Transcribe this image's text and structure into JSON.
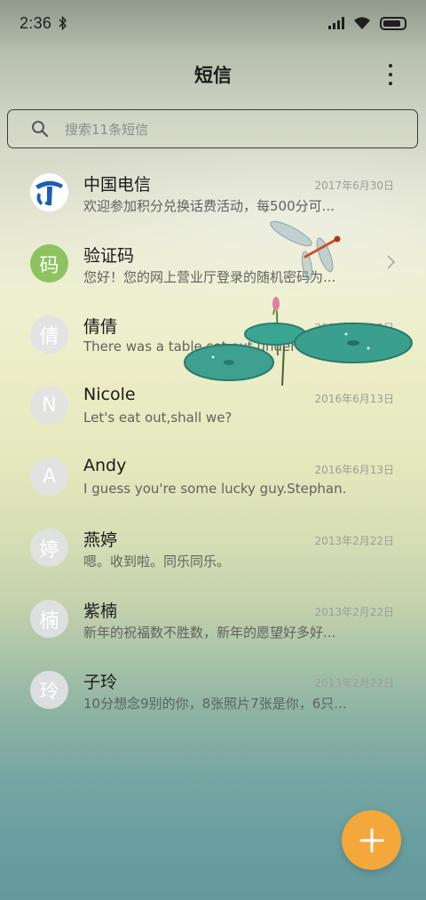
{
  "status": {
    "time": "2:36"
  },
  "header": {
    "title": "短信"
  },
  "search": {
    "placeholder": "搜索11条短信"
  },
  "threads": [
    {
      "name": "中国电信",
      "date": "2017年6月30日",
      "preview": "欢迎参加积分兑换话费活动，每500分可...",
      "avatar": "",
      "avatar_type": "logo"
    },
    {
      "name": "验证码",
      "date": "",
      "preview": "您好！您的网上营业厅登录的随机密码为...",
      "avatar": "码",
      "avatar_type": "green"
    },
    {
      "name": "倩倩",
      "date": "2016年6月13日",
      "preview": "There was a table set out under a tree i...",
      "avatar": "倩",
      "avatar_type": "grey"
    },
    {
      "name": "Nicole",
      "date": "2016年6月13日",
      "preview": "Let's eat out,shall we?",
      "avatar": "N",
      "avatar_type": "grey"
    },
    {
      "name": "Andy",
      "date": "2016年6月13日",
      "preview": "I guess you're some lucky guy.Stephan...",
      "avatar": "A",
      "avatar_type": "grey"
    },
    {
      "name": "燕婷",
      "date": "2013年2月22日",
      "preview": "嗯。收到啦。同乐同乐。",
      "avatar": "婷",
      "avatar_type": "grey"
    },
    {
      "name": "紫楠",
      "date": "2013年2月22日",
      "preview": "新年的祝福数不胜数，新年的愿望好多好...",
      "avatar": "楠",
      "avatar_type": "grey"
    },
    {
      "name": "子玲",
      "date": "2013年2月22日",
      "preview": "10分想念9别的你，8张照片7张是你，6只...",
      "avatar": "玲",
      "avatar_type": "grey"
    }
  ],
  "icons": {
    "bluetooth": "bluetooth-icon",
    "signal": "signal-icon",
    "wifi": "wifi-icon",
    "battery": "battery-icon",
    "more": "more-vertical-icon",
    "search": "search-icon",
    "chevron": "chevron-right-icon",
    "compose": "plus-icon"
  },
  "colors": {
    "fab": "#f4a73b",
    "avatar_green": "#8dc35f",
    "avatar_grey": "#e1e2e4"
  }
}
